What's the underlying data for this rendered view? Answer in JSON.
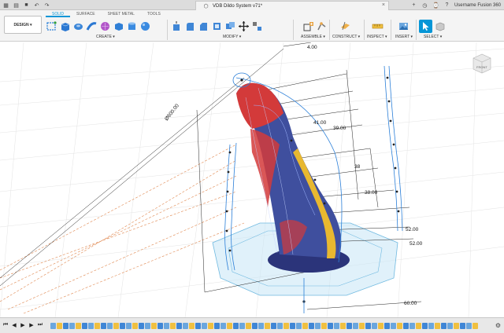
{
  "title_bar": {
    "document_title": "VDB Dildo System v71*",
    "user": "Username Fusion 360",
    "icons": [
      "grid-menu-icon",
      "file-icon",
      "save-icon",
      "undo-icon",
      "redo-icon",
      "close-icon",
      "add-tab-icon",
      "online-status-icon",
      "notifications-icon",
      "help-icon"
    ]
  },
  "toolbar": {
    "workspace": "DESIGN ▾",
    "tabs": [
      {
        "label": "SOLID",
        "active": true
      },
      {
        "label": "SURFACE",
        "active": false
      },
      {
        "label": "SHEET METAL",
        "active": false
      },
      {
        "label": "TOOLS",
        "active": false
      }
    ],
    "groups": {
      "create": "CREATE ▾",
      "modify": "MODIFY ▾",
      "assemble": "ASSEMBLE ▾",
      "construct": "CONSTRUCT ▾",
      "inspect": "INSPECT ▾",
      "insert": "INSERT ▾",
      "select": "SELECT ▾"
    }
  },
  "viewcube": {
    "face": "FRONT"
  },
  "dimensions": {
    "d1": "4.00",
    "d2": "Ø600.00",
    "d3": "41.00",
    "d4": "39.00",
    "d5": "38.00",
    "d6": "52.00",
    "d7": "52.00",
    "d8": "60.00",
    "d9": "38"
  },
  "colors": {
    "accent": "#0696d7",
    "sketch": "#2b7fd8",
    "dimension_line": "#222222",
    "construction": "#e08850",
    "body_red": "#d33a3a",
    "body_yellow": "#e8b830",
    "body_blue": "#3f4f9e"
  },
  "timeline": {
    "controls": [
      "skip-start-icon",
      "step-back-icon",
      "play-icon",
      "step-forward-icon",
      "skip-end-icon"
    ]
  }
}
